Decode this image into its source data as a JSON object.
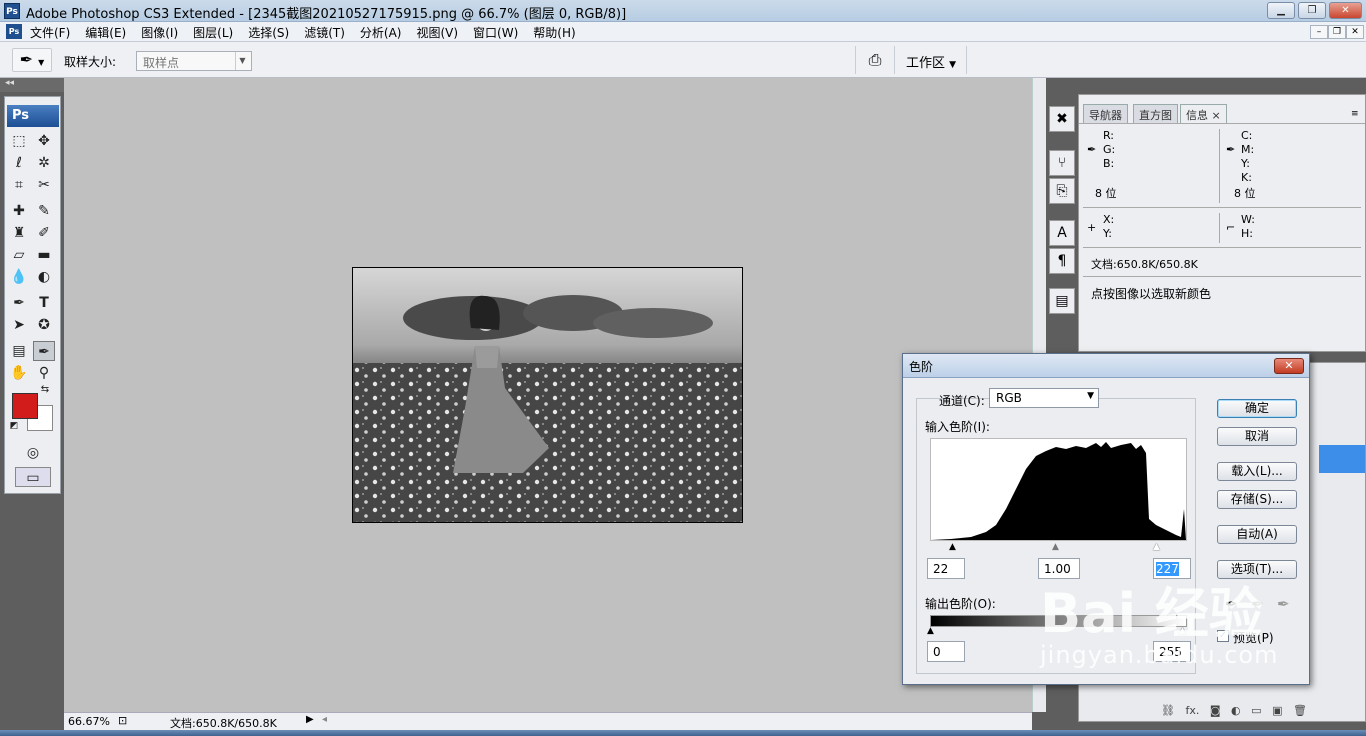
{
  "window": {
    "icon": "Ps",
    "title": "Adobe Photoshop CS3 Extended - [2345截图20210527175915.png @ 66.7% (图层 0, RGB/8)]"
  },
  "menubar": {
    "icon": "Ps",
    "items": [
      "文件(F)",
      "编辑(E)",
      "图像(I)",
      "图层(L)",
      "选择(S)",
      "滤镜(T)",
      "分析(A)",
      "视图(V)",
      "窗口(W)",
      "帮助(H)"
    ]
  },
  "options": {
    "sample_size_label": "取样大小:",
    "sample_size_value": "取样点",
    "workspace_label": "工作区"
  },
  "toolbox": {
    "logo": "Ps",
    "foreground_color": "#d21c1c",
    "background_color": "#ffffff"
  },
  "status": {
    "zoom": "66.67%",
    "doc": "文档:650.8K/650.8K"
  },
  "panel": {
    "tabs": [
      "导航器",
      "直方图",
      "信息"
    ],
    "active_tab": "信息",
    "rgb_labels": [
      "R:",
      "G:",
      "B:"
    ],
    "cmyk_labels": [
      "C:",
      "M:",
      "Y:",
      "K:"
    ],
    "bit_left": "8 位",
    "bit_right": "8 位",
    "xy_labels": [
      "X:",
      "Y:"
    ],
    "wh_labels": [
      "W:",
      "H:"
    ],
    "doc_info": "文档:650.8K/650.8K",
    "hint": "点按图像以选取新颜色"
  },
  "levels_dialog": {
    "title": "色阶",
    "channel_label": "通道(C):",
    "channel_value": "RGB",
    "input_levels_label": "输入色阶(I):",
    "input_black": "22",
    "input_gamma": "1.00",
    "input_white": "227",
    "output_levels_label": "输出色阶(O):",
    "output_black": "0",
    "output_white": "255",
    "buttons": [
      "确定",
      "取消",
      "载入(L)...",
      "存储(S)...",
      "自动(A)",
      "选项(T)..."
    ],
    "preview_label": "预览(P)",
    "preview_checked": true
  },
  "watermark": {
    "line1": "Bai  经验",
    "line2": "jingyan.baidu.com"
  }
}
